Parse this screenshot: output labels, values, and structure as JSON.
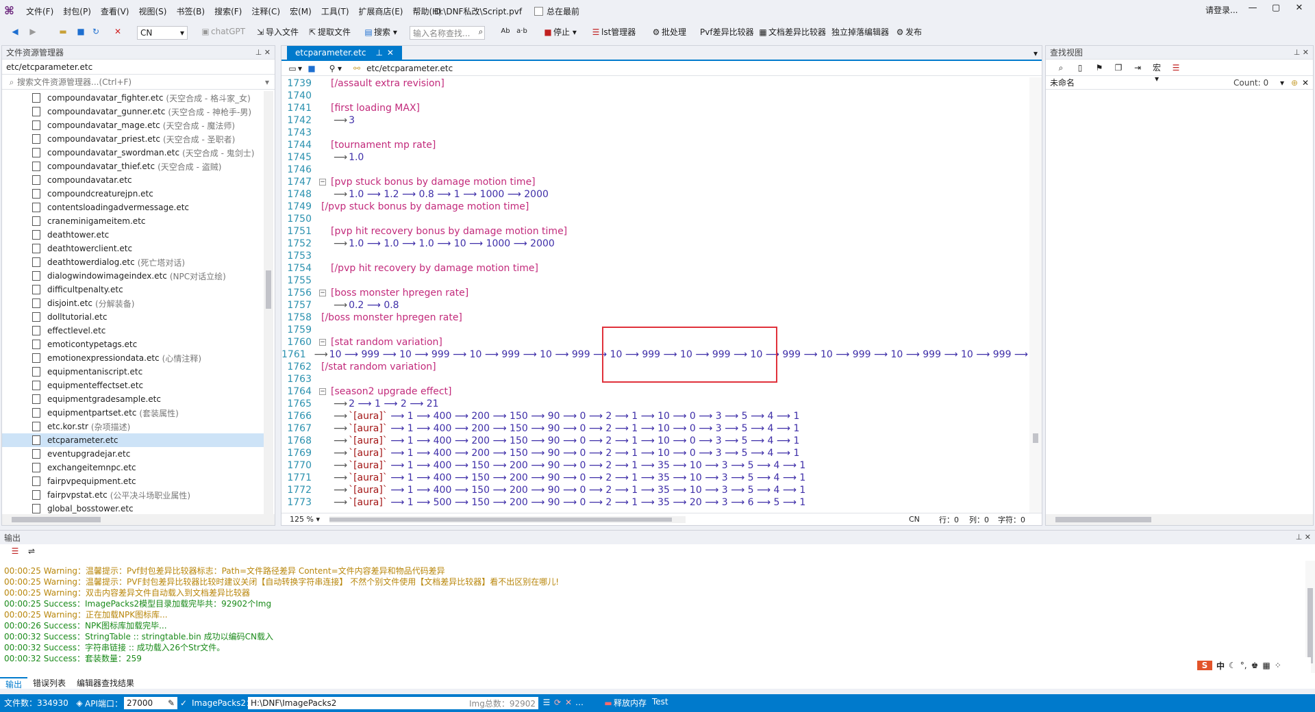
{
  "window": {
    "path": "D:\\DNF私改\\Script.pvf",
    "always_on_top": "总在最前",
    "login": "请登录...",
    "min": "—",
    "max": "▢",
    "close": "✕"
  },
  "menus": [
    "文件(F)",
    "封包(P)",
    "查看(V)",
    "视图(S)",
    "书签(B)",
    "搜索(F)",
    "注释(C)",
    "宏(M)",
    "工具(T)",
    "扩展商店(E)",
    "帮助(H)"
  ],
  "toolbar": {
    "lang": "CN",
    "chatgpt": "chatGPT",
    "import": "导入文件",
    "extract": "提取文件",
    "search": "搜索",
    "search_placeholder": "输入名称查找...",
    "stop": "停止",
    "lst": "lst管理器",
    "batch": "批处理",
    "pvfdiff": "Pvf差异比较器",
    "docdiff": "文档差异比较器",
    "dropedit": "独立掉落编辑器",
    "publish": "发布"
  },
  "explorer": {
    "title": "文件资源管理器",
    "path": "etc/etcparameter.etc",
    "search_placeholder": "搜索文件资源管理器...(Ctrl+F)",
    "items": [
      {
        "name": "compoundavatar_fighter.etc",
        "note": "(天空合成 - 格斗家_女)"
      },
      {
        "name": "compoundavatar_gunner.etc",
        "note": "(天空合成 - 神枪手-男)"
      },
      {
        "name": "compoundavatar_mage.etc",
        "note": "(天空合成 - 魔法师)"
      },
      {
        "name": "compoundavatar_priest.etc",
        "note": "(天空合成 - 圣职者)"
      },
      {
        "name": "compoundavatar_swordman.etc",
        "note": "(天空合成 - 鬼剑士)"
      },
      {
        "name": "compoundavatar_thief.etc",
        "note": "(天空合成 - 盗贼)"
      },
      {
        "name": "compoundavatar.etc",
        "note": ""
      },
      {
        "name": "compoundcreaturejpn.etc",
        "note": ""
      },
      {
        "name": "contentsloadingadvermessage.etc",
        "note": ""
      },
      {
        "name": "craneminigameitem.etc",
        "note": ""
      },
      {
        "name": "deathtower.etc",
        "note": ""
      },
      {
        "name": "deathtowerclient.etc",
        "note": ""
      },
      {
        "name": "deathtowerdialog.etc",
        "note": "(死亡塔对话)"
      },
      {
        "name": "dialogwindowimageindex.etc",
        "note": "(NPC对话立绘)"
      },
      {
        "name": "difficultpenalty.etc",
        "note": ""
      },
      {
        "name": "disjoint.etc",
        "note": "(分解装备)"
      },
      {
        "name": "dolltutorial.etc",
        "note": ""
      },
      {
        "name": "effectlevel.etc",
        "note": ""
      },
      {
        "name": "emoticontypetags.etc",
        "note": ""
      },
      {
        "name": "emotionexpressiondata.etc",
        "note": "(心情注释)"
      },
      {
        "name": "equipmentaniscript.etc",
        "note": ""
      },
      {
        "name": "equipmenteffectset.etc",
        "note": ""
      },
      {
        "name": "equipmentgradesample.etc",
        "note": ""
      },
      {
        "name": "equipmentpartset.etc",
        "note": "(套装属性)"
      },
      {
        "name": "etc.kor.str",
        "note": "(杂项描述)"
      },
      {
        "name": "etcparameter.etc",
        "note": ""
      },
      {
        "name": "eventupgradejar.etc",
        "note": ""
      },
      {
        "name": "exchangeitemnpc.etc",
        "note": ""
      },
      {
        "name": "fairpvpequipment.etc",
        "note": ""
      },
      {
        "name": "fairpvpstat.etc",
        "note": "(公平决斗场职业属性)"
      },
      {
        "name": "global_bosstower.etc",
        "note": ""
      }
    ]
  },
  "editor": {
    "tab": "etcparameter.etc",
    "path": "etc/etcparameter.etc",
    "zoom": "125 %",
    "lang": "CN",
    "row": "行：0",
    "col": "列：0",
    "char": "字符：0",
    "lines": [
      {
        "n": "1739",
        "t": "[/assault extra revision]",
        "k": "tag"
      },
      {
        "n": "1740",
        "t": "",
        "k": "blank"
      },
      {
        "n": "1741",
        "t": "[first loading MAX]",
        "k": "tag"
      },
      {
        "n": "1742",
        "t": "3",
        "k": "val"
      },
      {
        "n": "1743",
        "t": "",
        "k": "blank"
      },
      {
        "n": "1744",
        "t": "[tournament mp rate]",
        "k": "tag"
      },
      {
        "n": "1745",
        "t": "1.0",
        "k": "val"
      },
      {
        "n": "1746",
        "t": "",
        "k": "blank"
      },
      {
        "n": "1747",
        "t": "[pvp stuck bonus by damage motion time]",
        "k": "tag",
        "f": true
      },
      {
        "n": "1748",
        "t": "1.0 ⟶ 1.2 ⟶ 0.8 ⟶ 1 ⟶ 1000 ⟶ 2000",
        "k": "val"
      },
      {
        "n": "1749",
        "t": "[/pvp stuck bonus by damage motion time]",
        "k": "tagend"
      },
      {
        "n": "1750",
        "t": "",
        "k": "blank"
      },
      {
        "n": "1751",
        "t": "[pvp hit recovery bonus by damage motion time]",
        "k": "tag"
      },
      {
        "n": "1752",
        "t": "1.0 ⟶ 1.0 ⟶ 1.0 ⟶ 10 ⟶ 1000 ⟶ 2000",
        "k": "val"
      },
      {
        "n": "1753",
        "t": "",
        "k": "blank"
      },
      {
        "n": "1754",
        "t": "[/pvp hit recovery by damage motion time]",
        "k": "tag"
      },
      {
        "n": "1755",
        "t": "",
        "k": "blank"
      },
      {
        "n": "1756",
        "t": "[boss monster hpregen rate]",
        "k": "tag",
        "f": true
      },
      {
        "n": "1757",
        "t": "0.2 ⟶ 0.8",
        "k": "val"
      },
      {
        "n": "1758",
        "t": "[/boss monster hpregen rate]",
        "k": "tagend"
      },
      {
        "n": "1759",
        "t": "",
        "k": "blank"
      },
      {
        "n": "1760",
        "t": "[stat random variation]",
        "k": "tag",
        "f": true
      },
      {
        "n": "1761",
        "t": "10 ⟶ 999 ⟶ 10 ⟶ 999 ⟶ 10 ⟶ 999 ⟶ 10 ⟶ 999 ⟶ 10 ⟶ 999 ⟶ 10 ⟶ 999 ⟶ 10 ⟶ 999 ⟶ 10 ⟶ 999 ⟶ 10 ⟶ 999 ⟶ 10 ⟶ 999 ⟶",
        "k": "val"
      },
      {
        "n": "1762",
        "t": "[/stat random variation]",
        "k": "tagend"
      },
      {
        "n": "1763",
        "t": "",
        "k": "blank"
      },
      {
        "n": "1764",
        "t": "[season2 upgrade effect]",
        "k": "tag",
        "f": true
      },
      {
        "n": "1765",
        "t": "2 ⟶ 1 ⟶ 2 ⟶ 21",
        "k": "val"
      },
      {
        "n": "1766",
        "t": "`[aura]` ⟶ 1 ⟶ 400 ⟶ 200 ⟶ 150 ⟶ 90 ⟶ 0 ⟶ 2 ⟶ 1 ⟶ 10 ⟶ 0 ⟶ 3 ⟶ 5 ⟶ 4 ⟶ 1",
        "k": "aura"
      },
      {
        "n": "1767",
        "t": "`[aura]` ⟶ 1 ⟶ 400 ⟶ 200 ⟶ 150 ⟶ 90 ⟶ 0 ⟶ 2 ⟶ 1 ⟶ 10 ⟶ 0 ⟶ 3 ⟶ 5 ⟶ 4 ⟶ 1",
        "k": "aura"
      },
      {
        "n": "1768",
        "t": "`[aura]` ⟶ 1 ⟶ 400 ⟶ 200 ⟶ 150 ⟶ 90 ⟶ 0 ⟶ 2 ⟶ 1 ⟶ 10 ⟶ 0 ⟶ 3 ⟶ 5 ⟶ 4 ⟶ 1",
        "k": "aura"
      },
      {
        "n": "1769",
        "t": "`[aura]` ⟶ 1 ⟶ 400 ⟶ 200 ⟶ 150 ⟶ 90 ⟶ 0 ⟶ 2 ⟶ 1 ⟶ 10 ⟶ 0 ⟶ 3 ⟶ 5 ⟶ 4 ⟶ 1",
        "k": "aura"
      },
      {
        "n": "1770",
        "t": "`[aura]` ⟶ 1 ⟶ 400 ⟶ 150 ⟶ 200 ⟶ 90 ⟶ 0 ⟶ 2 ⟶ 1 ⟶ 35 ⟶ 10 ⟶ 3 ⟶ 5 ⟶ 4 ⟶ 1",
        "k": "aura"
      },
      {
        "n": "1771",
        "t": "`[aura]` ⟶ 1 ⟶ 400 ⟶ 150 ⟶ 200 ⟶ 90 ⟶ 0 ⟶ 2 ⟶ 1 ⟶ 35 ⟶ 10 ⟶ 3 ⟶ 5 ⟶ 4 ⟶ 1",
        "k": "aura"
      },
      {
        "n": "1772",
        "t": "`[aura]` ⟶ 1 ⟶ 400 ⟶ 150 ⟶ 200 ⟶ 90 ⟶ 0 ⟶ 2 ⟶ 1 ⟶ 35 ⟶ 10 ⟶ 3 ⟶ 5 ⟶ 4 ⟶ 1",
        "k": "aura"
      },
      {
        "n": "1773",
        "t": "`[aura]` ⟶ 1 ⟶ 500 ⟶ 150 ⟶ 200 ⟶ 90 ⟶ 0 ⟶ 2 ⟶ 1 ⟶ 35 ⟶ 20 ⟶ 3 ⟶ 6 ⟶ 5 ⟶ 1",
        "k": "aura"
      }
    ]
  },
  "findview": {
    "title": "查找视图",
    "name": "未命名",
    "count": "Count: 0"
  },
  "output": {
    "title": "输出",
    "logs": [
      {
        "t": "00:00:25 Warning：温馨提示：Pvf封包差异比较器标志：Path=文件路径差异 Content=文件内容差异和物品代码差异",
        "k": "warn"
      },
      {
        "t": "00:00:25 Warning：温馨提示：PVF封包差异比较器比较时建议关闭【自动转换字符串连接】 不然个别文件使用【文档差异比较器】看不出区别在哪儿!",
        "k": "warn"
      },
      {
        "t": "00:00:25 Warning：双击内容差异文件自动载入到文档差异比较器",
        "k": "warn"
      },
      {
        "t": "00:00:25 Success：ImagePacks2模型目录加载完毕共：92902个Img",
        "k": "succ"
      },
      {
        "t": "00:00:25 Warning：正在加载NPK图标库...",
        "k": "warn"
      },
      {
        "t": "00:00:26 Success：NPK图标库加载完毕...",
        "k": "succ"
      },
      {
        "t": "00:00:32 Success：StringTable :: stringtable.bin 成功以编码CN载入",
        "k": "succ"
      },
      {
        "t": "00:00:32 Success：字符串链接 :: 成功载入26个Str文件。",
        "k": "succ"
      },
      {
        "t": "00:00:32 Success：套装数量：259",
        "k": "succ"
      }
    ],
    "tabs": [
      "输出",
      "错误列表",
      "编辑器查找结果"
    ]
  },
  "statusbar": {
    "files": "文件数：334930",
    "api_label": "API端口：",
    "api_port": "27000",
    "imagepacks_label": "ImagePacks2：",
    "imagepacks_path": "H:\\DNF\\ImagePacks2",
    "img_total": "Img总数：92902",
    "free_mem": "释放内存",
    "test": "Test"
  },
  "ime": {
    "lang": "中"
  }
}
